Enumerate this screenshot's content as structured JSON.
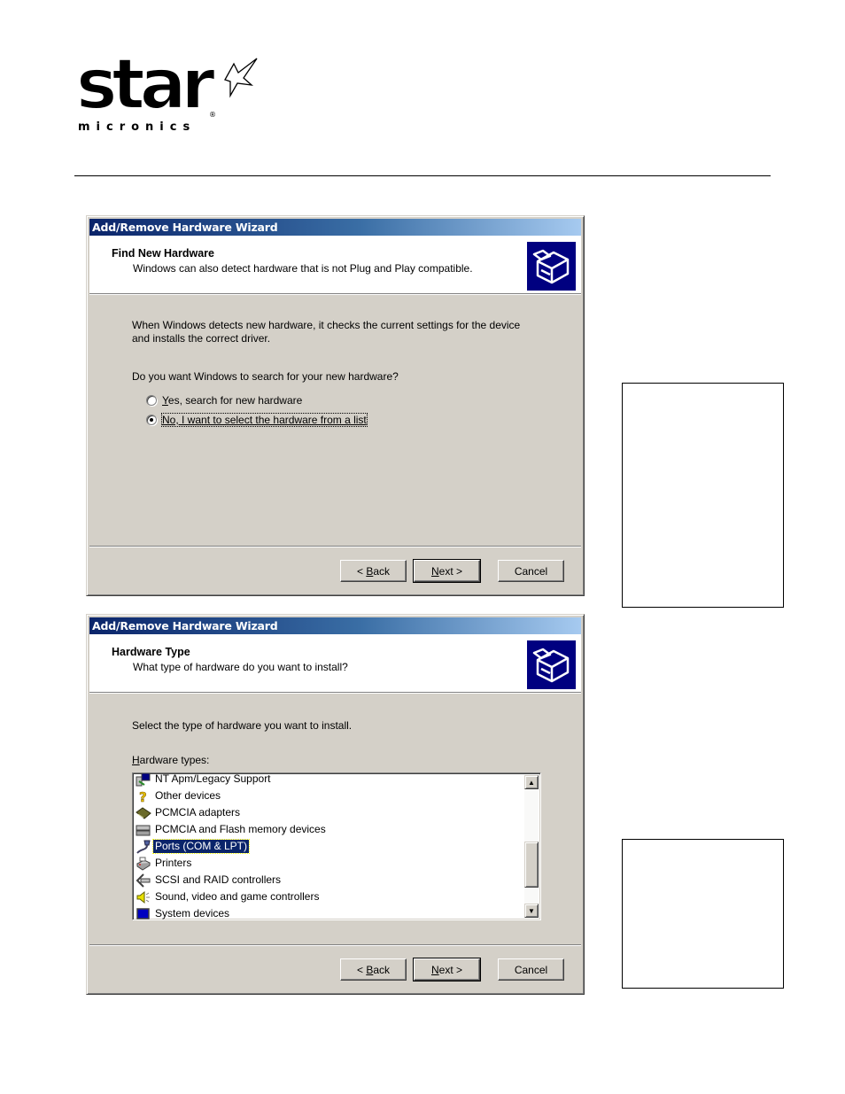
{
  "document": {
    "brand": {
      "wordmark": "star",
      "tagline": "micronics",
      "registered": "®",
      "logo_icon": "star-micronics-logo"
    },
    "callouts": [
      {
        "text": ""
      },
      {
        "text": ""
      }
    ]
  },
  "dialogs": [
    {
      "title": "Add/Remove Hardware Wizard",
      "header": {
        "title": "Find New Hardware",
        "subtitle": "Windows can also detect hardware that is not Plug and Play compatible.",
        "icon": "hardware-wizard-icon"
      },
      "body": {
        "paragraph_line1": "When Windows detects new hardware, it checks the current settings for the device",
        "paragraph_line2": "and installs the correct driver.",
        "question": "Do you want Windows to search for your new hardware?",
        "options": [
          {
            "label_accel": "Y",
            "label_rest": "es, search for new hardware",
            "checked": false
          },
          {
            "label_accel": "",
            "label_rest": "No, I want to select the hardware from a list",
            "checked": true
          }
        ]
      },
      "buttons": {
        "back_prefix": "< ",
        "back_accel": "B",
        "back_rest": "ack",
        "next_accel": "N",
        "next_rest": "ext >",
        "cancel": "Cancel"
      }
    },
    {
      "title": "Add/Remove Hardware Wizard",
      "header": {
        "title": "Hardware Type",
        "subtitle": "What type of hardware do you want to install?",
        "icon": "hardware-wizard-icon"
      },
      "body": {
        "instruction": "Select the type of hardware you want to install.",
        "list_label_accel": "H",
        "list_label_rest": "ardware types:",
        "list_items": [
          {
            "label": "NT Apm/Legacy Support",
            "icon": "legacy-computer-icon",
            "selected": false
          },
          {
            "label": "Other devices",
            "icon": "question-mark-icon",
            "selected": false
          },
          {
            "label": "PCMCIA adapters",
            "icon": "pcmcia-card-icon",
            "selected": false
          },
          {
            "label": "PCMCIA and Flash memory devices",
            "icon": "flash-memory-icon",
            "selected": false
          },
          {
            "label": "Ports (COM & LPT)",
            "icon": "port-connector-icon",
            "selected": true
          },
          {
            "label": "Printers",
            "icon": "printer-icon",
            "selected": false
          },
          {
            "label": "SCSI and RAID controllers",
            "icon": "scsi-icon",
            "selected": false
          },
          {
            "label": "Sound, video and game controllers",
            "icon": "speaker-icon",
            "selected": false
          },
          {
            "label": "System devices",
            "icon": "system-devices-icon",
            "selected": false
          }
        ]
      },
      "buttons": {
        "back_prefix": "< ",
        "back_accel": "B",
        "back_rest": "ack",
        "next_accel": "N",
        "next_rest": "ext >",
        "cancel": "Cancel"
      }
    }
  ],
  "colors": {
    "titlebar_start": "#0a246a",
    "titlebar_end": "#a6caf0",
    "dialog_face": "#d4d0c8",
    "selection": "#0a246a"
  }
}
